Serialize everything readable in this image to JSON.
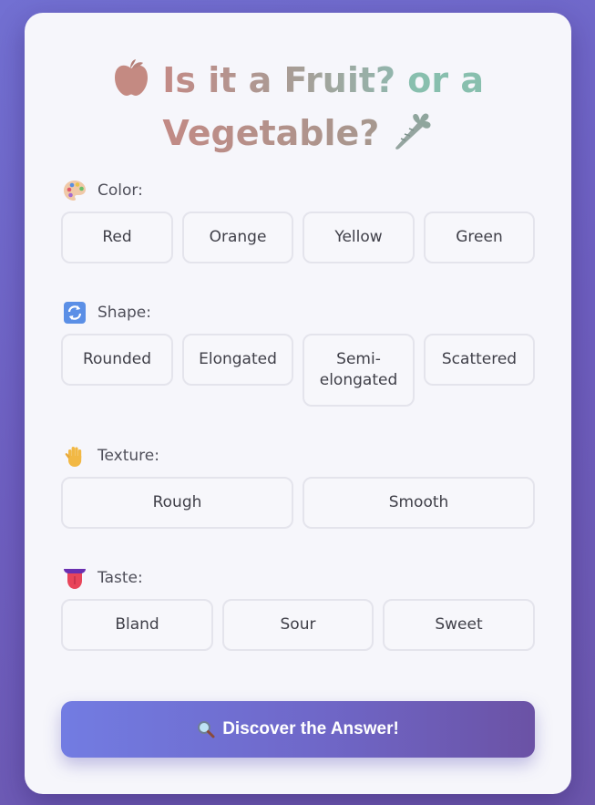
{
  "title": {
    "part1": "Is it a Fruit?",
    "part2": "or a",
    "part3": "Vegetable?",
    "icon_left": "apple-icon",
    "icon_right": "carrot-icon"
  },
  "sections": {
    "color": {
      "icon": "palette-icon",
      "label": "Color:",
      "options": [
        "Red",
        "Orange",
        "Yellow",
        "Green"
      ]
    },
    "shape": {
      "icon": "arrows-rotate-icon",
      "label": "Shape:",
      "options": [
        "Rounded",
        "Elongated",
        "Semi-elongated",
        "Scattered"
      ]
    },
    "texture": {
      "icon": "raised-hand-icon",
      "label": "Texture:",
      "options": [
        "Rough",
        "Smooth"
      ]
    },
    "taste": {
      "icon": "tongue-icon",
      "label": "Taste:",
      "options": [
        "Bland",
        "Sour",
        "Sweet"
      ]
    }
  },
  "submit": {
    "icon": "magnifier-icon",
    "label": "Discover the Answer!"
  },
  "colors": {
    "background": "#6e5fc0",
    "card": "#f6f6fb",
    "accent_start": "#727ce2",
    "accent_end": "#6b52a5"
  }
}
